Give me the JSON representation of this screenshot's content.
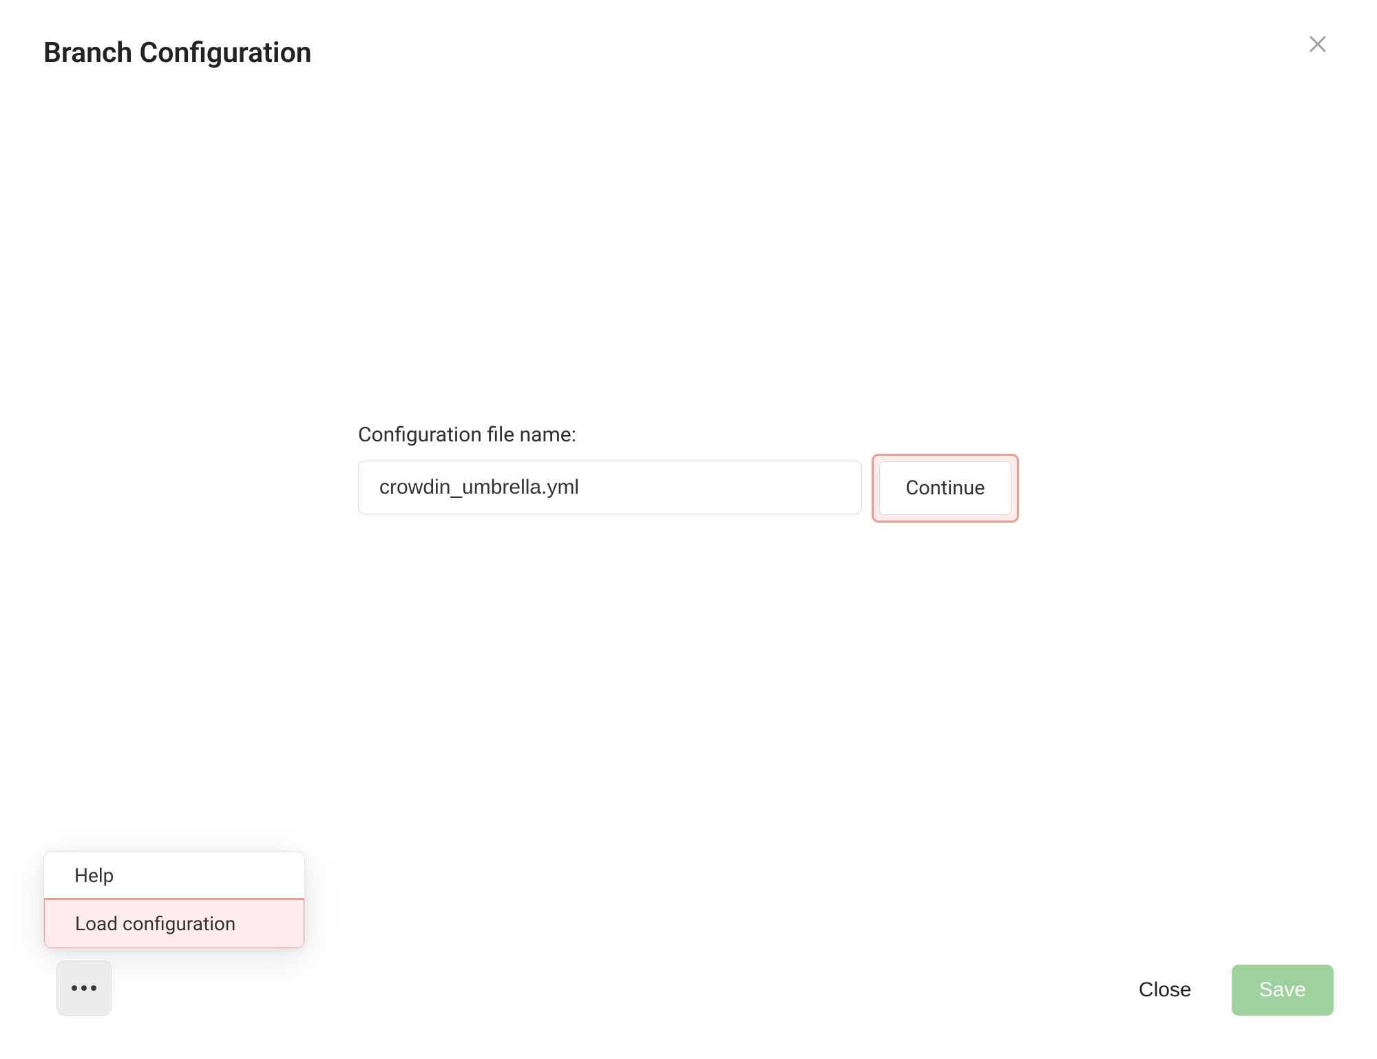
{
  "header": {
    "title": "Branch Configuration"
  },
  "form": {
    "label": "Configuration file name:",
    "filename_value": "crowdin_umbrella.yml",
    "continue_label": "Continue"
  },
  "popover": {
    "items": [
      {
        "label": "Help",
        "highlighted": false
      },
      {
        "label": "Load configuration",
        "highlighted": true
      }
    ]
  },
  "footer": {
    "close_label": "Close",
    "save_label": "Save"
  }
}
